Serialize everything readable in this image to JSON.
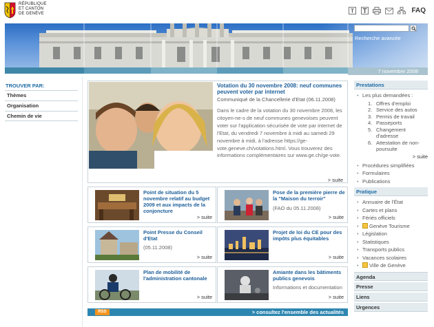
{
  "header": {
    "logo_lines": [
      "RÉPUBLIQUE",
      "ET CANTON",
      "DE GENÈVE"
    ],
    "faq": "FAQ",
    "icons": [
      "text-smaller-icon",
      "text-larger-icon",
      "print-icon",
      "mail-icon",
      "sitemap-icon"
    ]
  },
  "banner": {
    "search_placeholder": "",
    "advanced_search": "Recherche avancée",
    "date": "7 novembre 2008"
  },
  "leftnav": {
    "heading": "TROUVER PAR:",
    "items": [
      "Thèmes",
      "Organisation",
      "Chemin de vie"
    ]
  },
  "feature": {
    "title": "Votation du 30 novembre 2008: neuf communes peuvent voter par internet",
    "subtitle": "Communiqué de la Chancellerie d'Etat (06.11.2008)",
    "body": "Dans le cadre de la votation du 30 novembre 2008, les citoyen-ne-s de neuf communes genevoises peuvent voter sur l'application sécurisée de vote par internet de l'Etat, du vendredi 7 novembre à midi au samedi 29 novembre à midi, à l'adresse https://ge-vote.geneve.ch/votations.html. Vous trouverez des informations complémentaires sur www.ge.ch/ge-vote.",
    "suite": "> suite"
  },
  "news": [
    {
      "title": "Point de situation du 5 novembre relatif au budget 2009 et aux impacts de la conjoncture",
      "sub": "",
      "suite": "> suite"
    },
    {
      "title": "Pose de la première pierre de la \"Maison du terroir\"",
      "sub": "(FAO du 05.11.2008)",
      "suite": "> suite"
    },
    {
      "title": "Point Presse du Conseil d'Etat",
      "sub": "(05.11.2008)",
      "suite": "> suite"
    },
    {
      "title": "Projet de loi du CE pour des impôts plus équitables",
      "sub": "",
      "suite": "> suite"
    },
    {
      "title": "Plan de mobilité de l'administration cantonale",
      "sub": "",
      "suite": "> suite"
    },
    {
      "title": "Amiante dans les bâtiments publics genevois",
      "sub": "Informations et documentation",
      "suite": "> suite"
    }
  ],
  "rss": {
    "badge": "RSS",
    "link": "> consultez l'ensemble des actualités"
  },
  "right": {
    "prestations": {
      "heading": "Prestations",
      "most_requested": "Les plus demandées :",
      "items": [
        "Offres d'emploi",
        "Service des autos",
        "Permis de travail",
        "Passeports",
        "Changement d'adresse",
        "Attestation de non-poursuite"
      ],
      "suite": "> suite",
      "links": [
        "Procédures simplifiées",
        "Formulaires",
        "Publications"
      ]
    },
    "pratique": {
      "heading": "Pratique",
      "links": [
        "Annuaire de l'État",
        "Cartes et plans",
        "Fériés officiels",
        "Genève Tourisme",
        "Législation",
        "Statistiques",
        "Transports publics",
        "Vacances scolaires",
        "Ville de Genève"
      ]
    },
    "sections": [
      "Agenda",
      "Presse",
      "Liens",
      "Urgences"
    ]
  }
}
